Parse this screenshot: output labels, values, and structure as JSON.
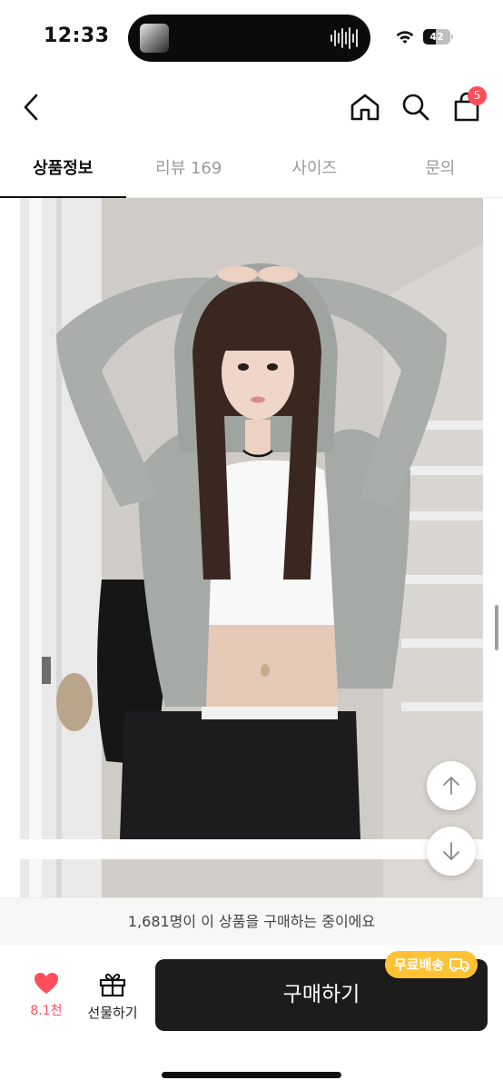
{
  "status_bar": {
    "time": "12:33",
    "battery": "42"
  },
  "header": {
    "back_icon": "chevron-left-icon",
    "home_icon": "home-icon",
    "search_icon": "search-icon",
    "cart_icon": "shopping-bag-icon",
    "cart_badge": "5",
    "badge_color": "#ff4e5b"
  },
  "tabs": [
    {
      "label": "상품정보",
      "active": true
    },
    {
      "label": "리뷰 169",
      "active": false
    },
    {
      "label": "사이즈",
      "active": false
    },
    {
      "label": "문의",
      "active": false
    }
  ],
  "content": {
    "scroll_up_icon": "arrow-up-icon",
    "scroll_down_icon": "arrow-down-icon"
  },
  "notice": {
    "text": "1,681명이 이 상품을 구매하는 중이에요"
  },
  "bottom_bar": {
    "like_icon": "heart-icon",
    "like_count": "8.1천",
    "gift_icon": "gift-icon",
    "gift_label": "선물하기",
    "buy_label": "구매하기",
    "shipping_badge": "무료배송",
    "shipping_icon": "truck-icon",
    "buy_color": "#1c1c1c",
    "shipping_color": "#ffc234"
  }
}
